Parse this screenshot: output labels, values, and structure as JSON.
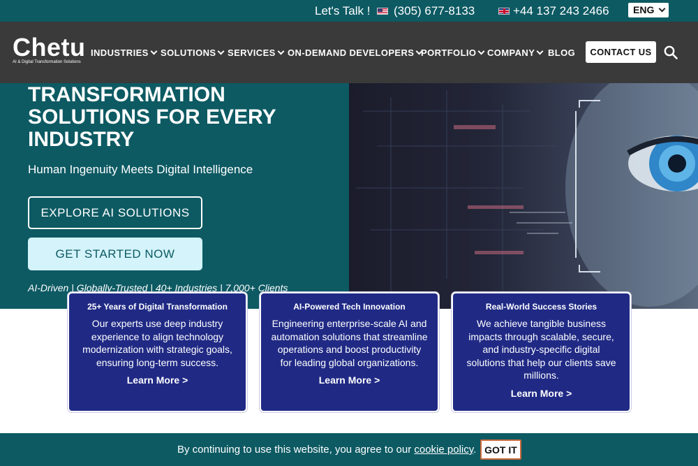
{
  "topbar": {
    "talk": "Let's Talk !",
    "phone_us": "(305) 677-8133",
    "phone_uk": "+44 137 243 2466",
    "language": "ENG"
  },
  "nav": {
    "logo_name": "Chetu",
    "logo_tagline": "AI & Digital Transformation Solutions",
    "items": [
      "INDUSTRIES",
      "SOLUTIONS",
      "SERVICES",
      "ON-DEMAND DEVELOPERS",
      "PORTFOLIO",
      "COMPANY",
      "BLOG"
    ],
    "contact_label": "CONTACT US"
  },
  "hero": {
    "title": "TRANSFORMATION SOLUTIONS FOR EVERY INDUSTRY",
    "subtitle": "Human Ingenuity Meets Digital Intelligence",
    "explore_label": "EXPLORE AI SOLUTIONS",
    "start_label": "GET STARTED NOW",
    "tagline": "AI-Driven | Globally-Trusted | 40+ Industries | 7,000+ Clients"
  },
  "cards": [
    {
      "title": "25+ Years of Digital Transformation",
      "body": "Our experts use deep industry experience to align technology modernization with strategic goals, ensuring long-term success.",
      "link": "Learn More >"
    },
    {
      "title": "AI-Powered Tech Innovation",
      "body": "Engineering enterprise-scale AI and automation solutions that streamline operations and boost productivity for leading global organizations.",
      "link": "Learn More >"
    },
    {
      "title": "Real-World Success Stories",
      "body": "We achieve tangible business impacts through scalable, secure, and industry-specific digital solutions that help our clients save millions.",
      "link": "Learn More >"
    }
  ],
  "cookie": {
    "message": "By continuing to use this website, you agree to our",
    "policy_link": "cookie policy",
    "period": ".",
    "button": "GOT IT"
  },
  "colors": {
    "teal": "#0d5a63",
    "nav_bg": "#3a3a3a",
    "card_bg": "#202a85",
    "start_btn_bg": "#d4f3fa"
  }
}
